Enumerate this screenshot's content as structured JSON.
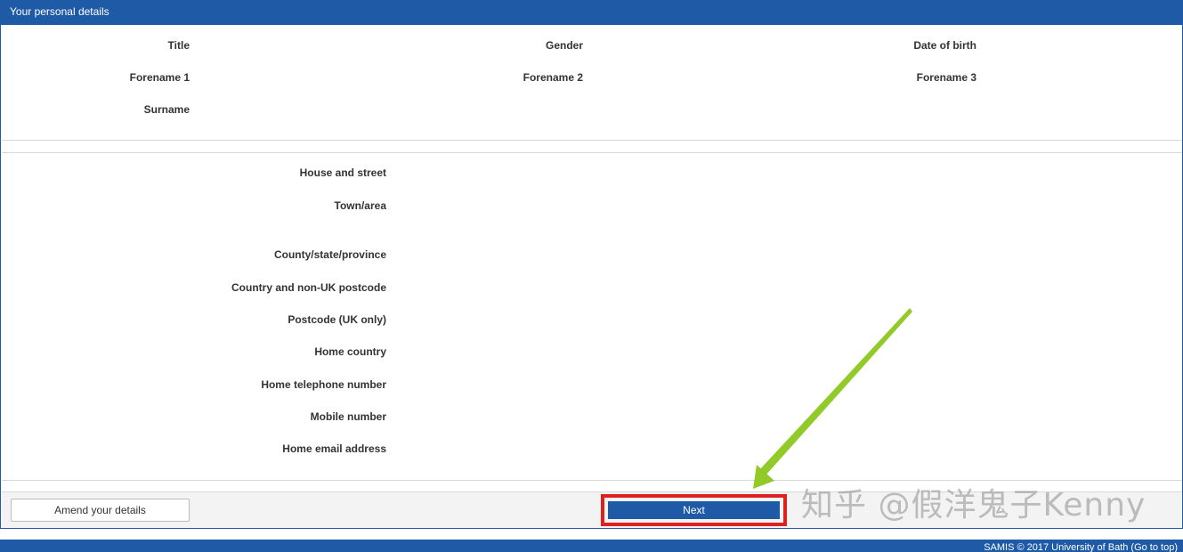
{
  "panel": {
    "title": "Your personal details"
  },
  "name_section": {
    "title_label": "Title",
    "gender_label": "Gender",
    "dob_label": "Date of birth",
    "forename1_label": "Forename 1",
    "forename2_label": "Forename 2",
    "forename3_label": "Forename 3",
    "surname_label": "Surname"
  },
  "address_section": {
    "labels": [
      "House and street",
      "Town/area",
      "County/state/province",
      "Country and non-UK postcode",
      "Postcode (UK only)",
      "Home country",
      "Home telephone number",
      "Mobile number",
      "Home email address"
    ]
  },
  "actions": {
    "amend_label": "Amend your details",
    "next_label": "Next"
  },
  "watermark": "知乎 @假洋鬼子Kenny",
  "footer": {
    "text": "SAMIS © 2017 University of Bath (Go to top)"
  },
  "colors": {
    "brand_blue": "#1f5aa6",
    "highlight_red": "#e02020",
    "arrow_green": "#8cc71e"
  }
}
